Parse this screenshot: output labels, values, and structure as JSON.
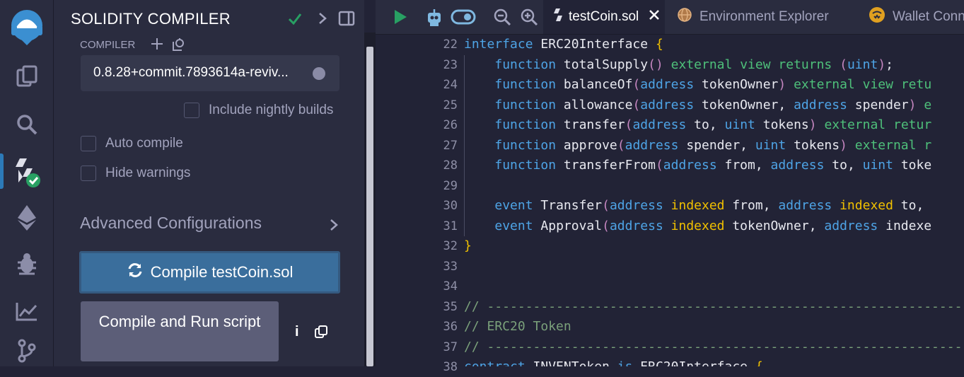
{
  "icon_bar": {
    "items": [
      "logo-icon",
      "file-explorer-icon",
      "search-icon",
      "solidity-compiler-icon",
      "deploy-run-icon",
      "debugger-icon",
      "analytics-icon",
      "git-icon"
    ],
    "accent": "#2c7ab8"
  },
  "panel": {
    "title": "SOLIDITY COMPILER",
    "compiler_label": "COMPILER",
    "compiler_version": "0.8.28+commit.7893614a-reviv...",
    "include_nightly": "Include nightly builds",
    "auto_compile": "Auto compile",
    "hide_warnings": "Hide warnings",
    "advanced": "Advanced Configurations",
    "compile_button": "Compile testCoin.sol",
    "compile_run_button": "Compile and Run script",
    "info_glyph": "i"
  },
  "toolbar": {
    "tabs": [
      {
        "label": "testCoin.sol"
      },
      {
        "label": "Environment Explorer"
      },
      {
        "label": "Wallet Conn"
      }
    ]
  },
  "editor": {
    "line_numbers": [
      "22",
      "23",
      "24",
      "25",
      "26",
      "27",
      "28",
      "29",
      "30",
      "31",
      "32",
      "33",
      "34",
      "35",
      "36",
      "37",
      "38"
    ],
    "lines": [
      "interface ERC20Interface {",
      "    function totalSupply() external view returns (uint);",
      "    function balanceOf(address tokenOwner) external view retu",
      "    function allowance(address tokenOwner, address spender) e",
      "    function transfer(address to, uint tokens) external retur",
      "    function approve(address spender, uint tokens) external r",
      "    function transferFrom(address from, address to, uint toke",
      "",
      "    event Transfer(address indexed from, address indexed to, ",
      "    event Approval(address indexed tokenOwner, address indexe",
      "}",
      "",
      "",
      "// ----------------------------------------------------------------",
      "// ERC20 Token",
      "// ----------------------------------------------------------------",
      "contract INVENToken is ERC20Interface {"
    ]
  },
  "colors": {
    "keyword": "#4ea4e6",
    "modifier": "#4ec07a",
    "brace": "#f0c000",
    "comment": "#7aa07a"
  }
}
